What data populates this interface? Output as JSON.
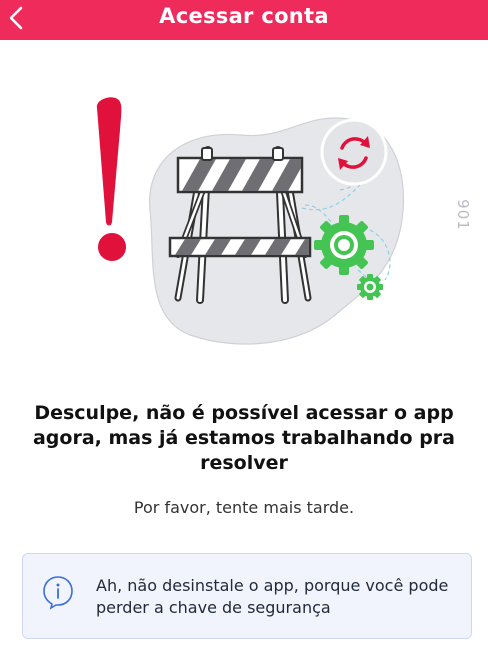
{
  "header": {
    "title": "Acessar conta",
    "back_icon": "chevron-left-icon",
    "background_color": "#ef2b5c"
  },
  "illustration": {
    "description_icons": [
      "exclamation-icon",
      "road-barrier-icon",
      "refresh-icon",
      "gear-icon"
    ],
    "accent_red": "#e0113a",
    "accent_green": "#44c553"
  },
  "side_code": "901",
  "message": {
    "headline": "Desculpe, não é possível acessar o app agora, mas já estamos trabalhando pra resolver",
    "subtext": "Por favor, tente mais tarde."
  },
  "notice": {
    "icon": "info-icon",
    "text": "Ah, não desinstale o app, porque você pode perder a chave de segurança",
    "background_color": "#f1f4fd",
    "border_color": "#cfd8f3"
  }
}
